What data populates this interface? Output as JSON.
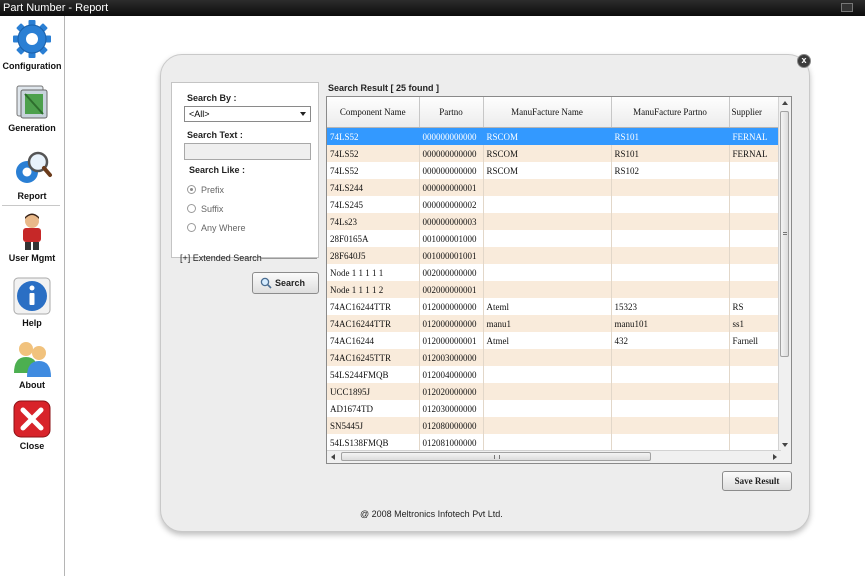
{
  "window": {
    "title": "Part Number - Report"
  },
  "sidebar": {
    "items": [
      {
        "label": "Configuration",
        "icon": "gear-icon"
      },
      {
        "label": "Generation",
        "icon": "generation-icon"
      },
      {
        "label": "Report",
        "icon": "report-icon"
      },
      {
        "label": "User Mgmt",
        "icon": "user-icon"
      },
      {
        "label": "Help",
        "icon": "info-icon"
      },
      {
        "label": "About",
        "icon": "people-icon"
      },
      {
        "label": "Close",
        "icon": "close-icon"
      }
    ]
  },
  "search": {
    "search_by_label": "Search By :",
    "search_by_value": "<All>",
    "search_text_label": "Search Text :",
    "search_text_value": "",
    "search_like_label": "Search Like :",
    "options": [
      "Prefix",
      "Suffix",
      "Any Where"
    ],
    "selected_option": "Prefix",
    "extended_label": "[+]  Extended Search",
    "button_label": "Search"
  },
  "results": {
    "label": "Search Result [ 25 found ]",
    "columns": [
      "Component Name",
      "Partno",
      "ManuFacture Name",
      "ManuFacture Partno",
      "Supplier"
    ],
    "rows": [
      [
        "74LS52",
        "000000000000",
        "RSCOM",
        "RS101",
        "FERNAL"
      ],
      [
        "74LS52",
        "000000000000",
        "RSCOM",
        "RS101",
        "FERNAL"
      ],
      [
        "74LS52",
        "000000000000",
        "RSCOM",
        "RS102",
        ""
      ],
      [
        "74LS244",
        "000000000001",
        "",
        "",
        ""
      ],
      [
        "74LS245",
        "000000000002",
        "",
        "",
        ""
      ],
      [
        "74Ls23",
        "000000000003",
        "",
        "",
        ""
      ],
      [
        "28F0165A",
        "001000001000",
        "",
        "",
        ""
      ],
      [
        "28F640J5",
        "001000001001",
        "",
        "",
        ""
      ],
      [
        "Node 1 1 1 1 1",
        "002000000000",
        "",
        "",
        ""
      ],
      [
        "Node 1 1 1 1 2",
        "002000000001",
        "",
        "",
        ""
      ],
      [
        "74AC16244TTR",
        "012000000000",
        "Ateml",
        "15323",
        "RS"
      ],
      [
        "74AC16244TTR",
        "012000000000",
        "manu1",
        "manu101",
        "ss1"
      ],
      [
        "74AC16244",
        "012000000001",
        "Atmel",
        "432",
        "Farnell"
      ],
      [
        "74AC16245TTR",
        "012003000000",
        "",
        "",
        ""
      ],
      [
        "54LS244FMQB",
        "012004000000",
        "",
        "",
        ""
      ],
      [
        "UCC1895J",
        "012020000000",
        "",
        "",
        ""
      ],
      [
        "AD1674TD",
        "012030000000",
        "",
        "",
        ""
      ],
      [
        "SN5445J",
        "012080000000",
        "",
        "",
        ""
      ],
      [
        "54LS138FMQB",
        "012081000000",
        "",
        "",
        ""
      ]
    ],
    "selected_row": 0,
    "save_label": "Save Result"
  },
  "footer": {
    "copyright": "@ 2008 Meltronics Infotech Pvt Ltd."
  },
  "colors": {
    "selection": "#3399ff",
    "row_alt": "#f9ebdb",
    "accent_blue": "#2a7fd4",
    "close_red": "#d8232a"
  }
}
